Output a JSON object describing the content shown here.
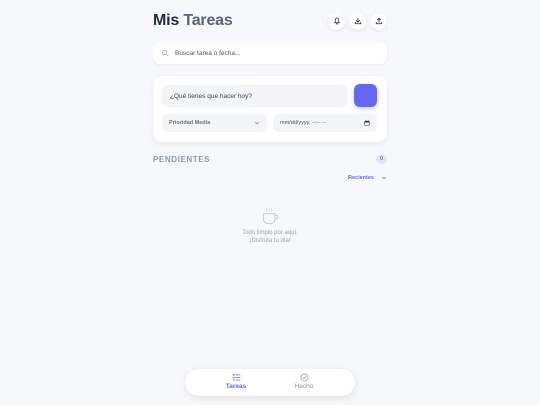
{
  "header": {
    "title_part1": "Mis",
    "title_part2": "Tareas",
    "actions": [
      {
        "icon": "bell-icon"
      },
      {
        "icon": "download-icon"
      },
      {
        "icon": "upload-icon"
      }
    ]
  },
  "search": {
    "placeholder": "Buscar tarea o fecha..."
  },
  "new_task": {
    "placeholder": "¿Qué tienes que hacer hoy?",
    "priority_value": "Prioridad Media",
    "date_placeholder": "mm/dd/yyyy, --:-- --"
  },
  "pending": {
    "title": "PENDIENTES",
    "count": "0",
    "sort_label": "Recientes"
  },
  "empty_state": {
    "line1": "Todo limpio por aquí.",
    "line2": "¡Disfruta tu día!"
  },
  "nav": {
    "tasks_label": "Tareas",
    "done_label": "Hecho"
  },
  "colors": {
    "accent": "#6366f1",
    "background": "#f7f8fb"
  }
}
